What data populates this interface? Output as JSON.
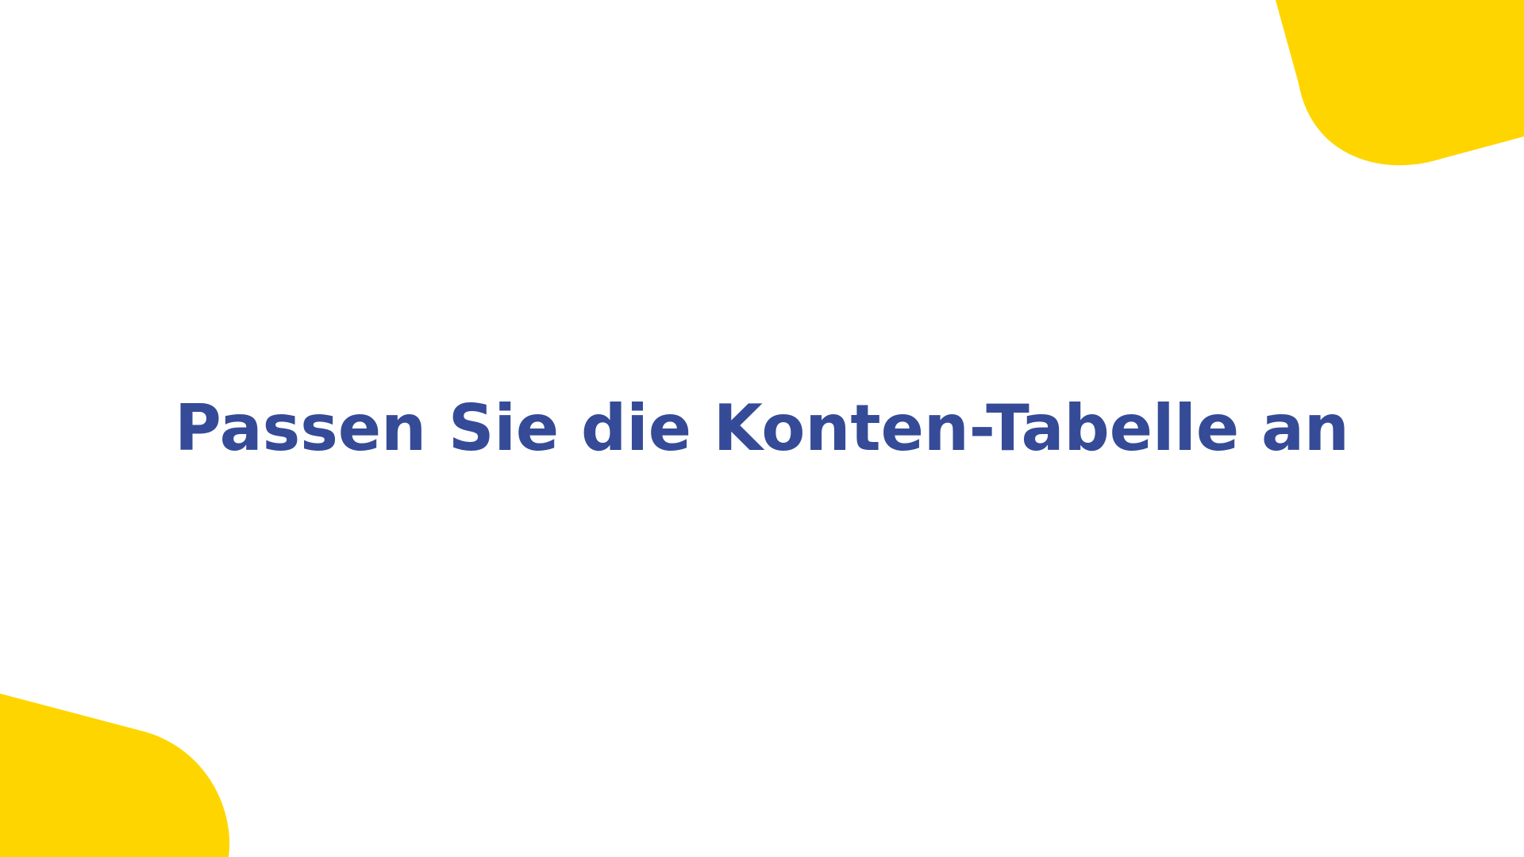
{
  "slide": {
    "title": "Passen Sie die Konten-Tabelle an"
  },
  "colors": {
    "title_text": "#354b97",
    "accent_shape": "#ffd500",
    "background": "#ffffff"
  }
}
